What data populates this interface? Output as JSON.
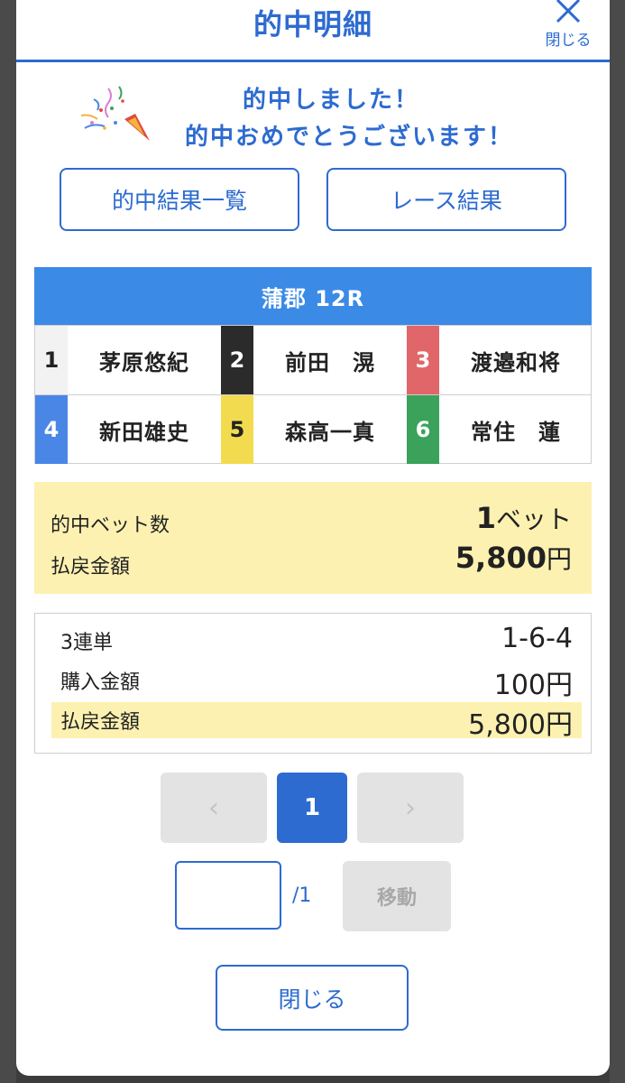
{
  "header": {
    "title": "的中明細",
    "close_label": "閉じる"
  },
  "congrats": {
    "line1": "的中しました！",
    "line2": "的中おめでとうございます！"
  },
  "buttons": {
    "results_list": "的中結果一覧",
    "race_results": "レース結果"
  },
  "race": {
    "title": "蒲郡 12R",
    "racers": [
      {
        "num": "1",
        "name": "茅原悠紀",
        "bg": "#f2f2f2",
        "fg": "#222222"
      },
      {
        "num": "2",
        "name": "前田　滉",
        "bg": "#2b2b2b",
        "fg": "#ffffff"
      },
      {
        "num": "3",
        "name": "渡邉和将",
        "bg": "#e0666a",
        "fg": "#ffffff"
      },
      {
        "num": "4",
        "name": "新田雄史",
        "bg": "#4a86e6",
        "fg": "#ffffff"
      },
      {
        "num": "5",
        "name": "森高一真",
        "bg": "#f2db4e",
        "fg": "#222222"
      },
      {
        "num": "6",
        "name": "常住　蓮",
        "bg": "#3aa25a",
        "fg": "#ffffff"
      }
    ]
  },
  "summary": {
    "bets_label": "的中ベット数",
    "bets_value": "1",
    "bets_unit": "ベット",
    "payout_label": "払戻金額",
    "payout_value": "5,800",
    "payout_unit": "円"
  },
  "detail": {
    "type_label": "3連単",
    "combo": "1-6-4",
    "purchase_label": "購入金額",
    "purchase_value": "100円",
    "payout_label": "払戻金額",
    "payout_value": "5,800円"
  },
  "pagination": {
    "prev": "‹",
    "current": "1",
    "next": "›",
    "input_value": "",
    "total": "/1",
    "move_label": "移動"
  },
  "footer": {
    "close_label": "閉じる"
  },
  "colors": {
    "accent": "#2d6bd0",
    "race_header": "#3b8ae6",
    "highlight": "#fdf1b2"
  }
}
